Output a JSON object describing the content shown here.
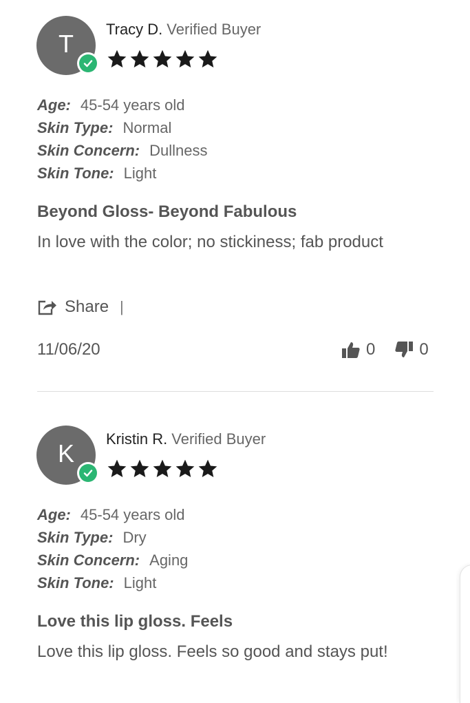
{
  "labels": {
    "verified": "Verified Buyer",
    "age": "Age:",
    "skin_type": "Skin Type:",
    "skin_concern": "Skin Concern:",
    "skin_tone": "Skin Tone:",
    "share": "Share",
    "share_separator": "|"
  },
  "colors": {
    "verified_badge": "#2bb673",
    "avatar": "#6b6b6b",
    "star": "#1a1a1a"
  },
  "reviews": [
    {
      "initial": "T",
      "name": "Tracy D.",
      "rating": 5,
      "age": "45-54 years old",
      "skin_type": "Normal",
      "skin_concern": "Dullness",
      "skin_tone": "Light",
      "title": "Beyond Gloss- Beyond Fabulous",
      "body": "In love with the color; no stickiness; fab product",
      "date": "11/06/20",
      "helpful": "0",
      "not_helpful": "0"
    },
    {
      "initial": "K",
      "name": "Kristin R.",
      "rating": 5,
      "age": "45-54 years old",
      "skin_type": "Dry",
      "skin_concern": "Aging",
      "skin_tone": "Light",
      "title": "Love this lip gloss. Feels",
      "body": "Love this lip gloss. Feels so good and stays put!"
    }
  ]
}
